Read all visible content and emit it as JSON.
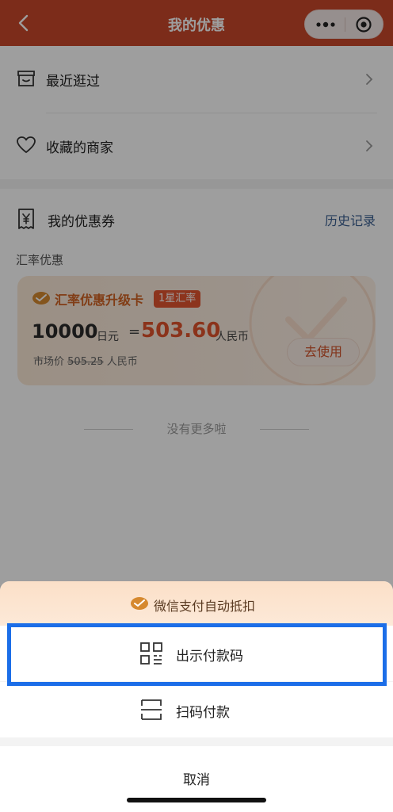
{
  "nav": {
    "title": "我的优惠"
  },
  "menu": {
    "recent": "最近逛过",
    "favorites": "收藏的商家"
  },
  "coupons": {
    "title": "我的优惠券",
    "history_link": "历史记录",
    "category": "汇率优惠",
    "card": {
      "name": "汇率优惠升级卡",
      "badge": "1星汇率",
      "amount": "10000",
      "amount_unit": "日元",
      "equals": "=",
      "rate_value": "503.60",
      "rate_unit": "人民币",
      "market_prefix": "市场价",
      "market_value": "505.25",
      "market_unit": "人民币",
      "use_button": "去使用"
    },
    "no_more": "没有更多啦"
  },
  "sheet": {
    "header": "微信支付自动抵扣",
    "options": [
      {
        "label": "出示付款码"
      },
      {
        "label": "扫码付款"
      }
    ],
    "cancel": "取消"
  },
  "colors": {
    "nav_bg": "#c8472a",
    "accent": "#e0532c",
    "highlight": "#1c6ee8"
  }
}
